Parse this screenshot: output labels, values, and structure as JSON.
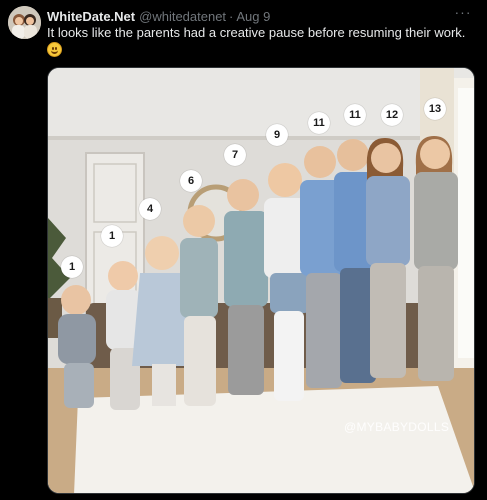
{
  "tweet": {
    "display_name": "WhiteDate.Net",
    "handle": "@whitedatenet",
    "separator": "·",
    "timestamp": "Aug 9",
    "more_icon": "more-horizontal-icon",
    "text": "It looks like the parents had a creative pause before resuming their work.",
    "emoji": "smiling-face-emoji"
  },
  "photo": {
    "watermark": "@MYBABYDOLLS",
    "number_labels": [
      "1",
      "1",
      "4",
      "6",
      "7",
      "9",
      "11",
      "11",
      "12",
      "13"
    ]
  },
  "colors": {
    "background": "#000000",
    "primary_text": "#e7e9ea",
    "secondary_text": "#71767b"
  }
}
